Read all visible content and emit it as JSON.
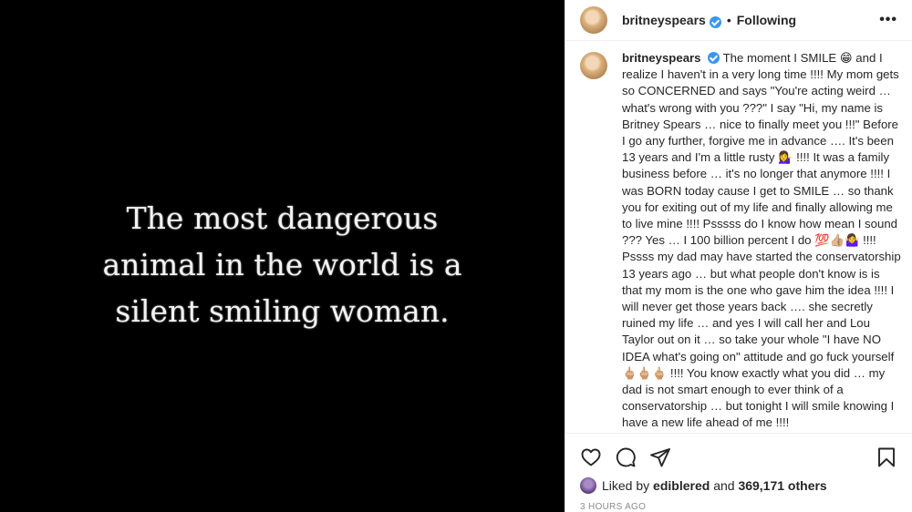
{
  "post": {
    "image_quote": "The most dangerous\nanimal in the world is a\nsilent smiling woman."
  },
  "header": {
    "username": "britneyspears",
    "separator": "•",
    "follow_status": "Following",
    "more_label": "•••"
  },
  "caption": {
    "username": "britneyspears",
    "text": "The moment I SMILE 😁 and I realize I haven't in a very long time !!!! My mom gets so CONCERNED and says \"You're acting weird … what's wrong with you ???\"  I say \"Hi, my name is Britney Spears … nice to finally meet you !!!\" Before I go any further, forgive me in advance …. It's been 13 years and I'm a little rusty 💁‍♀️ !!!! It was a family business before … it's no longer that anymore !!!! I was BORN today cause I get to SMILE … so thank you for exiting out of my life and finally allowing me to live mine !!!! Psssss do I know how mean I sound ???  Yes … I 100 billion percent I do 💯👍🏼🤷‍♀️ !!!! Pssss my dad may have started the conservatorship 13 years ago … but what people don't know is is that my mom is the one who gave him the idea !!!! I will never get those years back …. she secretly ruined my life … and yes I will call her and Lou Taylor out on it … so take your whole \"I have NO IDEA what's going on\" attitude and go fuck yourself 🖕🏼🖕🏼🖕🏼 !!!! You know exactly what you did … my dad is not smart enough to ever think of a conservatorship … but tonight I will smile knowing I have a new life ahead of me !!!!"
  },
  "actions": {
    "icons": [
      "heart-icon",
      "comment-icon",
      "share-icon",
      "bookmark-icon"
    ]
  },
  "likes": {
    "prefix": "Liked by",
    "user": "ediblered",
    "conjunction": "and",
    "others": "369,171 others"
  },
  "timestamp": "3 HOURS AGO",
  "colors": {
    "verified": "#3897f0",
    "media_background": "#000000",
    "muted_text": "#8e8e8e"
  }
}
